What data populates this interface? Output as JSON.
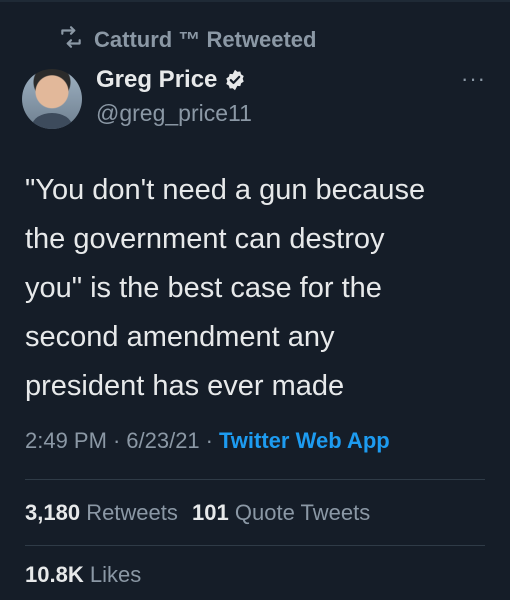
{
  "social_context": {
    "text": "Catturd ™ Retweeted"
  },
  "author": {
    "name": "Greg Price",
    "handle": "@greg_price11"
  },
  "tweet": {
    "text": "\"You don't need a gun because\nthe government can destroy\nyou\" is the best case for the\nsecond amendment any\npresident has ever made"
  },
  "meta": {
    "time": "2:49 PM",
    "date": "6/23/21",
    "app": "Twitter Web App",
    "sep": "·"
  },
  "stats": {
    "retweets_count": "3,180",
    "retweets_label": "Retweets",
    "quotes_count": "101",
    "quotes_label": "Quote Tweets",
    "likes_count": "10.8K",
    "likes_label": "Likes"
  },
  "colors": {
    "background": "#151d28",
    "text": "#e7e9ea",
    "muted": "#8b98a5",
    "link": "#1d9bf0",
    "verified": "#e7e9ea"
  },
  "icons": {
    "retweet": "retweet-icon",
    "verified": "verified-badge-icon",
    "more": "more-icon"
  }
}
